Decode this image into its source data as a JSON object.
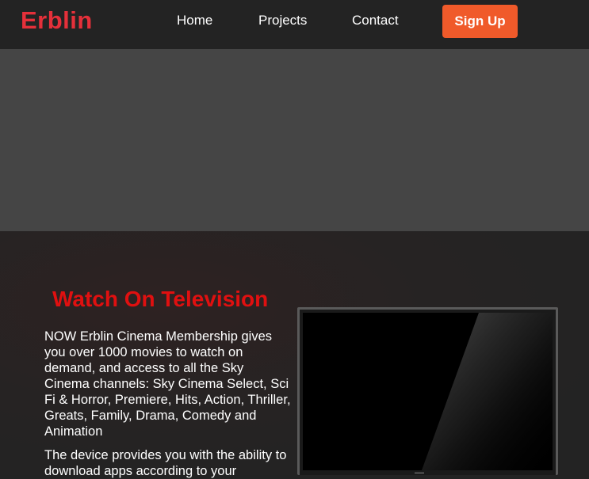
{
  "nav": {
    "logo": "Erblin",
    "links": [
      "Home",
      "Projects",
      "Contact"
    ],
    "signup": "Sign Up"
  },
  "section": {
    "title": "Watch On Television",
    "paragraph_1": "NOW Erblin Cinema Membership gives you over 1000 movies to watch on demand, and access to all the Sky Cinema channels: Sky Cinema Select, Sci Fi & Horror, Premiere, Hits, Action, Thriller, Greats, Family, Drama, Comedy and Animation",
    "paragraph_2": "The device provides you with the ability to download apps according to your"
  },
  "colors": {
    "logo": "#e5303a",
    "title": "#e01010",
    "signup_bg": "#f05a2a",
    "background": "#232323",
    "hero": "#454545"
  },
  "icons": [
    "television-icon"
  ]
}
